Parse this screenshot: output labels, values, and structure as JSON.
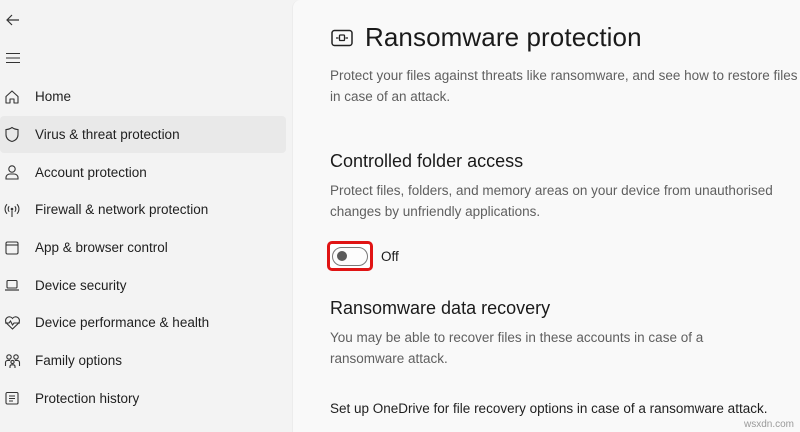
{
  "window": {
    "back_icon": "back-arrow-icon",
    "menu_icon": "hamburger-menu-icon"
  },
  "sidebar": {
    "items": [
      {
        "label": "Home",
        "icon": "home-icon",
        "active": false
      },
      {
        "label": "Virus & threat protection",
        "icon": "shield-icon",
        "active": true
      },
      {
        "label": "Account protection",
        "icon": "person-icon",
        "active": false
      },
      {
        "label": "Firewall & network protection",
        "icon": "antenna-icon",
        "active": false
      },
      {
        "label": "App & browser control",
        "icon": "app-window-icon",
        "active": false
      },
      {
        "label": "Device security",
        "icon": "laptop-icon",
        "active": false
      },
      {
        "label": "Device performance & health",
        "icon": "heart-pulse-icon",
        "active": false
      },
      {
        "label": "Family options",
        "icon": "family-icon",
        "active": false
      },
      {
        "label": "Protection history",
        "icon": "history-icon",
        "active": false
      }
    ]
  },
  "main": {
    "title": "Ransomware protection",
    "title_icon": "ransomware-shield-icon",
    "intro": "Protect your files against threats like ransomware, and see how to restore files in case of an attack.",
    "controlled_folder_access": {
      "title": "Controlled folder access",
      "description": "Protect files, folders, and memory areas on your device from unauthorised changes by unfriendly applications.",
      "toggle_state": "Off",
      "toggle_on": false
    },
    "data_recovery": {
      "title": "Ransomware data recovery",
      "description": "You may be able to recover files in these accounts in case of a ransomware attack.",
      "onedrive_text": "Set up OneDrive for file recovery options in case of a ransomware attack."
    }
  },
  "watermark": "wsxdn.com",
  "colors": {
    "highlight": "#e01414",
    "background": "#f3f3f3",
    "panel": "#f9f9f9"
  }
}
